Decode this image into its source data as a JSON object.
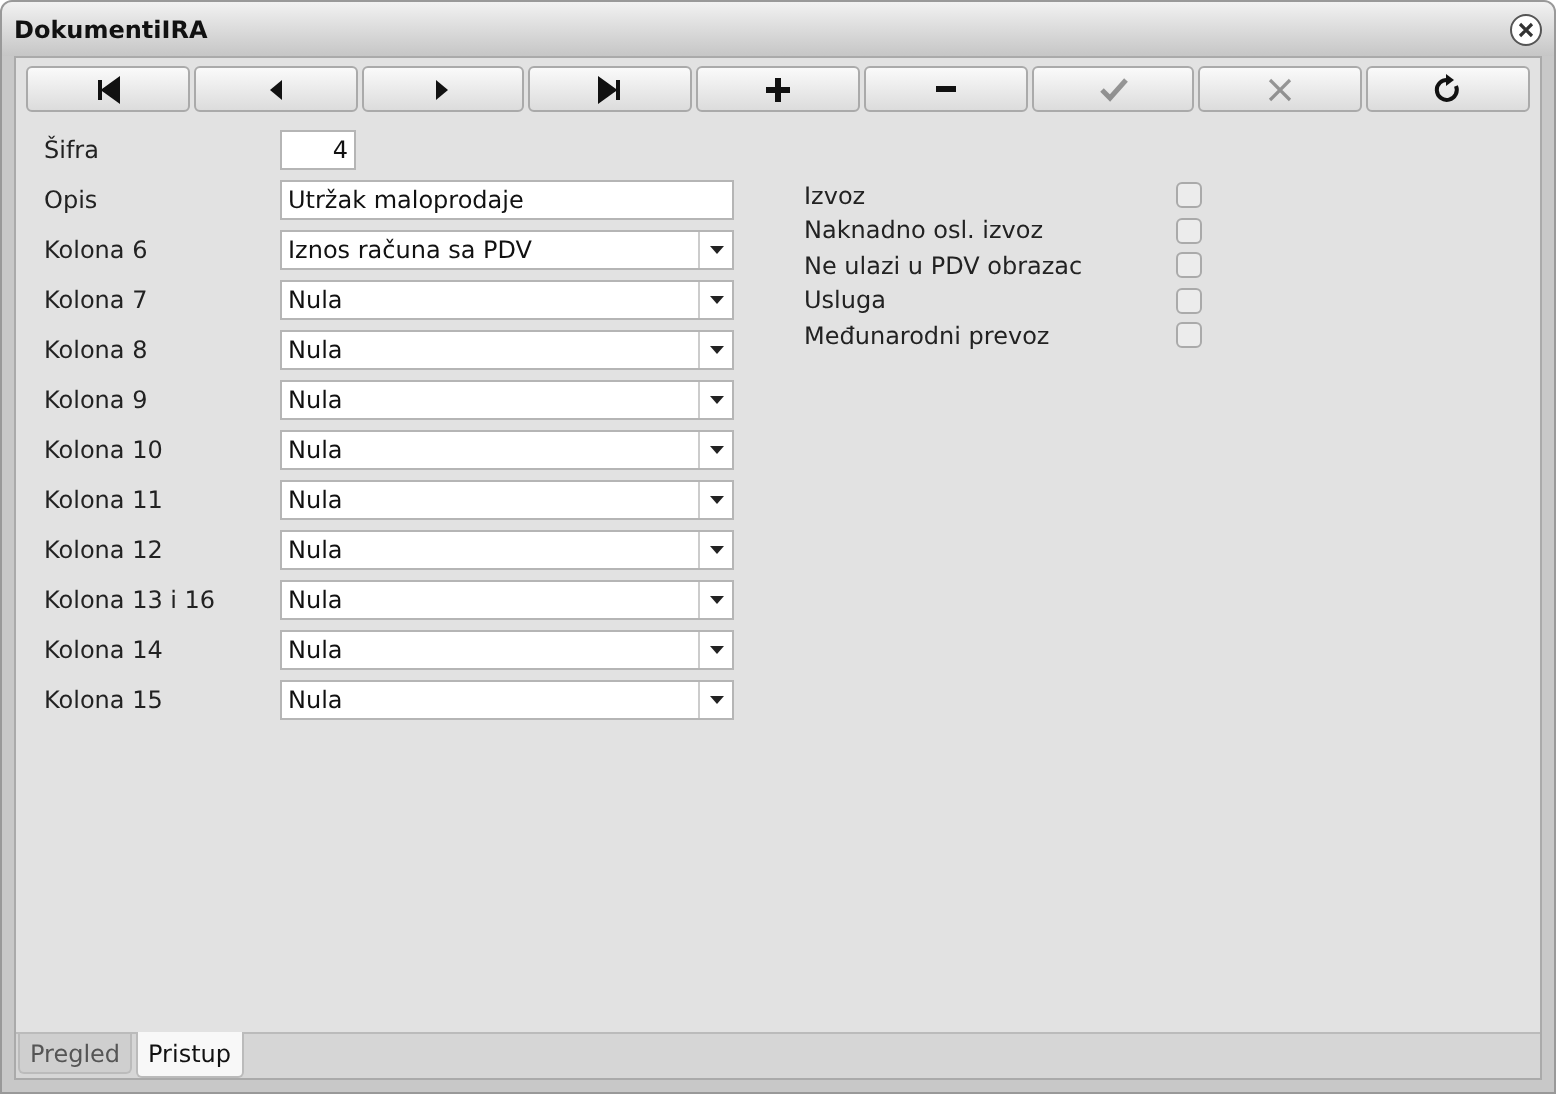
{
  "window": {
    "title": "DokumentiIRA"
  },
  "toolbar": [
    {
      "kind": "first",
      "disabled": false
    },
    {
      "kind": "prev",
      "disabled": false
    },
    {
      "kind": "next",
      "disabled": false
    },
    {
      "kind": "last",
      "disabled": false
    },
    {
      "kind": "add",
      "disabled": false
    },
    {
      "kind": "remove",
      "disabled": false
    },
    {
      "kind": "save",
      "disabled": true
    },
    {
      "kind": "cancel",
      "disabled": true
    },
    {
      "kind": "refresh",
      "disabled": false
    }
  ],
  "fields": [
    {
      "kind": "number",
      "label": "Šifra",
      "value": "4"
    },
    {
      "kind": "text",
      "label": "Opis",
      "value": "Utržak maloprodaje"
    },
    {
      "kind": "select",
      "label": "Kolona 6",
      "value": "Iznos računa sa PDV"
    },
    {
      "kind": "select",
      "label": "Kolona 7",
      "value": "Nula"
    },
    {
      "kind": "select",
      "label": "Kolona 8",
      "value": "Nula"
    },
    {
      "kind": "select",
      "label": "Kolona 9",
      "value": "Nula"
    },
    {
      "kind": "select",
      "label": "Kolona 10",
      "value": "Nula"
    },
    {
      "kind": "select",
      "label": "Kolona 11",
      "value": "Nula"
    },
    {
      "kind": "select",
      "label": "Kolona 12",
      "value": "Nula"
    },
    {
      "kind": "select",
      "label": "Kolona 13 i 16",
      "value": "Nula"
    },
    {
      "kind": "select",
      "label": "Kolona 14",
      "value": "Nula"
    },
    {
      "kind": "select",
      "label": "Kolona 15",
      "value": "Nula"
    }
  ],
  "checkboxes": [
    {
      "label": "Izvoz",
      "checked": false
    },
    {
      "label": "Naknadno osl. izvoz",
      "checked": false
    },
    {
      "label": "Ne ulazi u PDV obrazac",
      "checked": false
    },
    {
      "label": "Usluga",
      "checked": false
    },
    {
      "label": "Međunarodni prevoz",
      "checked": false
    }
  ],
  "tabs": [
    {
      "label": "Pregled",
      "selected": false
    },
    {
      "label": "Pristup",
      "selected": true
    }
  ]
}
